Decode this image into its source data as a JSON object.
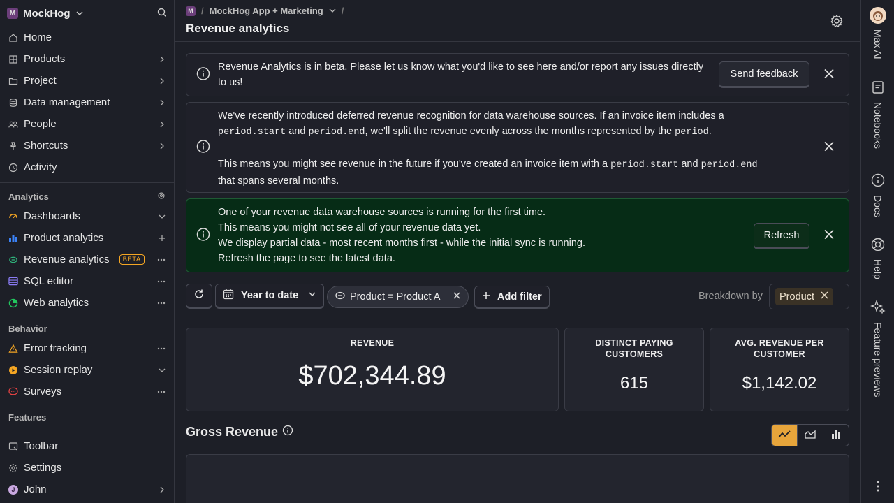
{
  "sidebar": {
    "org_badge": "M",
    "org_name": "MockHog",
    "nav": [
      {
        "label": "Home"
      },
      {
        "label": "Products"
      },
      {
        "label": "Project"
      },
      {
        "label": "Data management"
      },
      {
        "label": "People"
      },
      {
        "label": "Shortcuts"
      },
      {
        "label": "Activity"
      }
    ],
    "analytics_title": "Analytics",
    "analytics_items": [
      {
        "label": "Dashboards"
      },
      {
        "label": "Product analytics"
      },
      {
        "label": "Revenue analytics",
        "badge": "BETA"
      },
      {
        "label": "SQL editor"
      },
      {
        "label": "Web analytics"
      }
    ],
    "behavior_title": "Behavior",
    "behavior_items": [
      {
        "label": "Error tracking"
      },
      {
        "label": "Session replay"
      },
      {
        "label": "Surveys"
      }
    ],
    "features_title": "Features",
    "bottom_items": [
      {
        "label": "Toolbar"
      },
      {
        "label": "Settings"
      },
      {
        "label": "John",
        "avatar": "J"
      }
    ]
  },
  "header": {
    "crumb_badge": "M",
    "project": "MockHog App + Marketing",
    "title": "Revenue analytics"
  },
  "banners": {
    "beta": {
      "text": "Revenue Analytics is in beta. Please let us know what you'd like to see here and/or report any issues directly to us!",
      "button": "Send feedback"
    },
    "deferred": {
      "l1a": "We've recently introduced deferred revenue recognition for data warehouse sources. If an invoice item includes a",
      "code1": "period.start",
      "and1": " and ",
      "code2": "period.end",
      "l2b": ", we'll split the revenue evenly across the months represented by the ",
      "code3": "period",
      "l2c": ".",
      "l3a": "This means you might see revenue in the future if you've created an invoice item with a ",
      "code4": "period.start",
      "and2": " and ",
      "code5": "period.end",
      "l4": "that spans several months."
    },
    "sync": {
      "lines": [
        "One of your revenue data warehouse sources is running for the first time.",
        "This means you might not see all of your revenue data yet.",
        "We display partial data - most recent months first - while the initial sync is running.",
        "Refresh the page to see the latest data."
      ],
      "button": "Refresh"
    }
  },
  "filters": {
    "date_range": "Year to date",
    "chip": "Product = Product A",
    "add_filter": "Add filter",
    "breakdown_label": "Breakdown by",
    "breakdown_value": "Product"
  },
  "metrics": [
    {
      "label": "REVENUE",
      "value": "$702,344.89"
    },
    {
      "label": "DISTINCT PAYING CUSTOMERS",
      "value": "615"
    },
    {
      "label": "AVG. REVENUE PER CUSTOMER",
      "value": "$1,142.02"
    }
  ],
  "gross": {
    "title": "Gross Revenue",
    "active_view": "line",
    "accent": "#e7a53b"
  },
  "rail": {
    "items": [
      "Max AI",
      "Notebooks",
      "Docs",
      "Help",
      "Feature previews"
    ]
  }
}
